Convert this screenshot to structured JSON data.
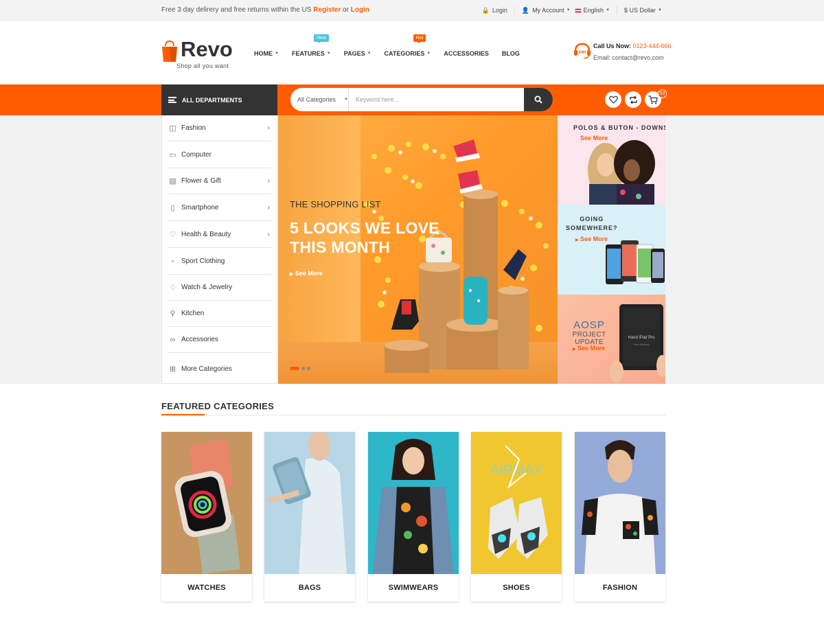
{
  "topbar": {
    "notice_text": "Free 3 day delirery and free returns within the US",
    "register": "Register",
    "or": "or",
    "login_link": "Login",
    "login": "Login",
    "my_account": "My Account",
    "language": "English",
    "currency": "$ US Dollar"
  },
  "header": {
    "logo": "Revo",
    "tagline": "Shop all you want",
    "nav": [
      {
        "label": "HOME",
        "has_dropdown": true
      },
      {
        "label": "FEATURES",
        "has_dropdown": true,
        "badge": "New"
      },
      {
        "label": "PAGES",
        "has_dropdown": true
      },
      {
        "label": "CATEGORIES",
        "has_dropdown": true,
        "badge": "Hot"
      },
      {
        "label": "ACCESSORIES",
        "has_dropdown": false
      },
      {
        "label": "BLOG",
        "has_dropdown": false
      }
    ],
    "call_label": "Call Us Now:",
    "phone": "0123-444-666",
    "email": "Email: contact@revo.com",
    "hours_badge": "24H"
  },
  "toolbar": {
    "all_departments": "ALL DEPARTMENTS",
    "search_category": "All Categories",
    "search_placeholder": "Keyword here...",
    "cart_count": "02"
  },
  "sidebar": {
    "items": [
      {
        "label": "Fashion",
        "icon": "shirt-icon",
        "has_submenu": true
      },
      {
        "label": "Computer",
        "icon": "laptop-icon",
        "has_submenu": false
      },
      {
        "label": "Flower & Gift",
        "icon": "car-icon",
        "has_submenu": true
      },
      {
        "label": "Smartphone",
        "icon": "phone-icon",
        "has_submenu": true
      },
      {
        "label": "Health & Beauty",
        "icon": "heart-icon",
        "has_submenu": true
      },
      {
        "label": "Sport Clothing",
        "icon": "shoe-icon",
        "has_submenu": false
      },
      {
        "label": "Watch & Jewelry",
        "icon": "diamond-icon",
        "has_submenu": false
      },
      {
        "label": "Kitchen",
        "icon": "spoon-icon",
        "has_submenu": false
      },
      {
        "label": "Accessories",
        "icon": "glasses-icon",
        "has_submenu": false
      },
      {
        "label": "More Categories",
        "icon": "plus-square-icon",
        "has_submenu": false
      }
    ]
  },
  "hero": {
    "subtitle": "THE SHOPPING LIST",
    "title_line1": "5 LOOKS WE LOVE",
    "title_line2": "THIS MONTH",
    "cta": "See More",
    "slides": 3,
    "active_slide": 1
  },
  "banners": [
    {
      "title": "POLOS & BUTON - DOWNS",
      "cta": "See More"
    },
    {
      "title_line1": "GOING",
      "title_line2": "SOMEWHERE?",
      "cta": "See More"
    },
    {
      "title_line1": "AOSP",
      "title_line2": "PROJECT UPDATE",
      "cta": "See More",
      "tablet_text_1": "Hand iPad Pro",
      "tablet_text_2": "Free Mockup"
    }
  ],
  "featured": {
    "title": "FEATURED CATEGORIES",
    "categories": [
      {
        "label": "WATCHES"
      },
      {
        "label": "BAGS"
      },
      {
        "label": "SWIMWEARS"
      },
      {
        "label": "SHOES",
        "art_text": "AIRMAX"
      },
      {
        "label": "FASHION"
      }
    ]
  },
  "colors": {
    "accent": "#ff5c00",
    "dark": "#333333",
    "new_badge": "#4fc3d9"
  }
}
